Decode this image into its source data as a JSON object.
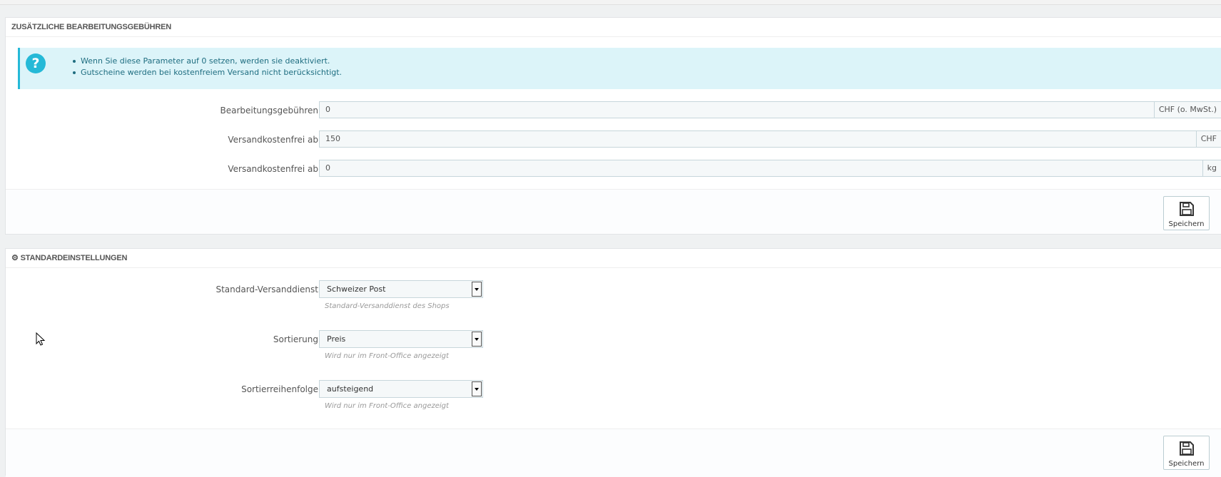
{
  "fees_panel": {
    "title": "ZUSÄTZLICHE BEARBEITUNGSGEBÜHREN",
    "info_icon": "question-circle-icon",
    "notes": [
      "Wenn Sie diese Parameter auf 0 setzen, werden sie deaktiviert.",
      "Gutscheine werden bei kostenfreiem Versand nicht berücksichtigt."
    ],
    "fields": [
      {
        "label": "Bearbeitungsgebühren",
        "value": "0",
        "unit": "CHF (o. MwSt.)"
      },
      {
        "label": "Versandkostenfrei ab",
        "value": "150",
        "unit": "CHF"
      },
      {
        "label": "Versandkostenfrei ab",
        "value": "0",
        "unit": "kg"
      }
    ],
    "save_label": "Speichern"
  },
  "defaults_panel": {
    "title": "STANDARDEINSTELLUNGEN",
    "title_icon": "cogs-icon",
    "fields": [
      {
        "label": "Standard-Versanddienst",
        "value": "Schweizer Post",
        "help": "Standard-Versanddienst des Shops"
      },
      {
        "label": "Sortierung",
        "value": "Preis",
        "help": "Wird nur im Front-Office angezeigt"
      },
      {
        "label": "Sortierreihenfolge",
        "value": "aufsteigend",
        "help": "Wird nur im Front-Office angezeigt"
      }
    ],
    "save_label": "Speichern"
  },
  "colors": {
    "info_bg": "#dcf4f9",
    "info_accent": "#25b9d7",
    "input_bg": "#f5f8f9"
  }
}
